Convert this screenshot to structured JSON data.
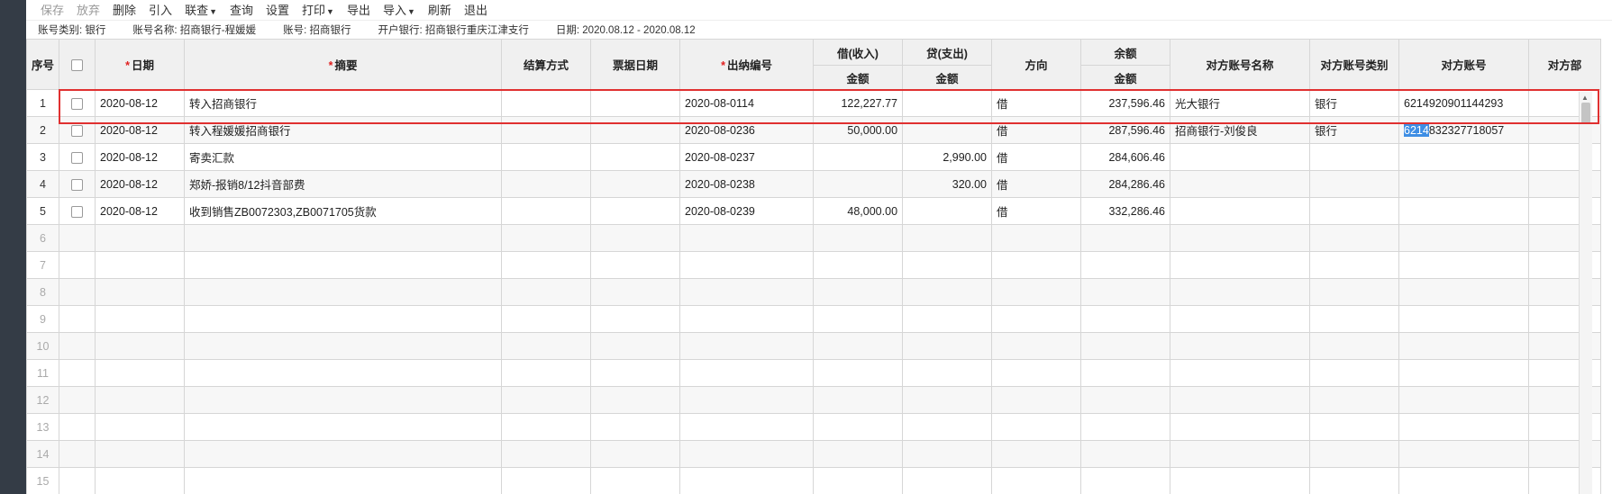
{
  "toolbar": {
    "save": "保存",
    "discard": "放弃",
    "delete": "删除",
    "import_ref": "引入",
    "linked_query": "联查",
    "query": "查询",
    "settings": "设置",
    "print": "打印",
    "export": "导出",
    "import": "导入",
    "refresh": "刷新",
    "exit": "退出"
  },
  "info": {
    "account_type": "账号类别: 银行",
    "account_name": "账号名称: 招商银行-程媛媛",
    "account_no": "账号: 招商银行",
    "bank": "开户银行: 招商银行重庆江津支行",
    "date_range": "日期: 2020.08.12 - 2020.08.12"
  },
  "columns": {
    "seq": "序号",
    "date": "日期",
    "summary": "摘要",
    "settle": "结算方式",
    "bill_date": "票据日期",
    "cash_no": "出纳编号",
    "debit": "借(收入)",
    "credit": "贷(支出)",
    "amount": "金额",
    "direction": "方向",
    "balance": "余额",
    "cp_name": "对方账号名称",
    "cp_type": "对方账号类别",
    "cp_no": "对方账号",
    "cp_dept": "对方部"
  },
  "rows": [
    {
      "seq": "1",
      "date": "2020-08-12",
      "summary": "转入招商银行",
      "settle": "",
      "bill_date": "",
      "cash_no": "2020-08-0114",
      "debit": "122,227.77",
      "credit": "",
      "direction": "借",
      "balance": "237,596.46",
      "cp_name": "光大银行",
      "cp_type": "银行",
      "cp_no": "6214920901144293",
      "cp_dept": ""
    },
    {
      "seq": "2",
      "date": "2020-08-12",
      "summary": "转入程媛媛招商银行",
      "settle": "",
      "bill_date": "",
      "cash_no": "2020-08-0236",
      "debit": "50,000.00",
      "credit": "",
      "direction": "借",
      "balance": "287,596.46",
      "cp_name": "招商银行-刘俊良",
      "cp_type": "银行",
      "cp_no_sel": "6214",
      "cp_no_rest": "832327718057",
      "cp_dept": ""
    },
    {
      "seq": "3",
      "date": "2020-08-12",
      "summary": "寄卖汇款",
      "settle": "",
      "bill_date": "",
      "cash_no": "2020-08-0237",
      "debit": "",
      "credit": "2,990.00",
      "direction": "借",
      "balance": "284,606.46",
      "cp_name": "",
      "cp_type": "",
      "cp_no": "",
      "cp_dept": ""
    },
    {
      "seq": "4",
      "date": "2020-08-12",
      "summary": "郑娇-报销8/12抖音部费",
      "settle": "",
      "bill_date": "",
      "cash_no": "2020-08-0238",
      "debit": "",
      "credit": "320.00",
      "direction": "借",
      "balance": "284,286.46",
      "cp_name": "",
      "cp_type": "",
      "cp_no": "",
      "cp_dept": ""
    },
    {
      "seq": "5",
      "date": "2020-08-12",
      "summary": "收到销售ZB0072303,ZB0071705货款",
      "settle": "",
      "bill_date": "",
      "cash_no": "2020-08-0239",
      "debit": "48,000.00",
      "credit": "",
      "direction": "借",
      "balance": "332,286.46",
      "cp_name": "",
      "cp_type": "",
      "cp_no": "",
      "cp_dept": ""
    }
  ],
  "empty_rows": [
    "6",
    "7",
    "8",
    "9",
    "10",
    "11",
    "12",
    "13",
    "14",
    "15"
  ]
}
